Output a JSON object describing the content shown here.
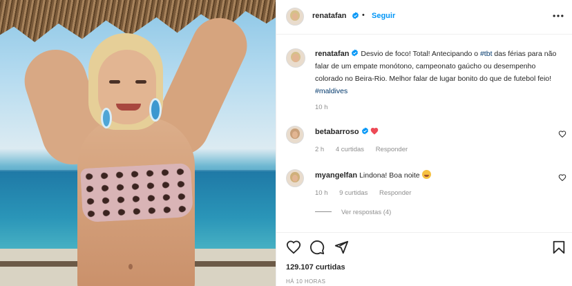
{
  "post": {
    "author": "renatafan",
    "follow_label": "Seguir",
    "separator": "•"
  },
  "caption": {
    "author": "renatafan",
    "text_before": "Desvio de foco! Total! Antecipando o ",
    "hashtag1": "#tbt",
    "text_middle": " das férias para não falar de um empate monótono, campeonato gaúcho ou desempenho colorado no Beira-Rio. Melhor falar de lugar bonito do que de futebol feio! ",
    "hashtag2": "#maldives",
    "time": "10 h"
  },
  "comments": [
    {
      "author": "betabarroso",
      "time": "2 h",
      "likes": "4 curtidas",
      "reply_label": "Responder"
    },
    {
      "author": "myangelfan",
      "text": "Lindona! Boa noite",
      "time": "10 h",
      "likes": "9 curtidas",
      "reply_label": "Responder"
    }
  ],
  "view_replies": "Ver respostas (4)",
  "likes_count": "129.107 curtidas",
  "time_ago": "HÁ 10 HORAS",
  "colors": {
    "link": "#0095f6",
    "hashtag": "#00376b",
    "muted": "#8e8e8e",
    "heart": "#ed4956"
  },
  "icons": [
    "verified-badge-icon",
    "more-options-icon",
    "heart-icon",
    "comment-icon",
    "share-icon",
    "bookmark-icon"
  ]
}
